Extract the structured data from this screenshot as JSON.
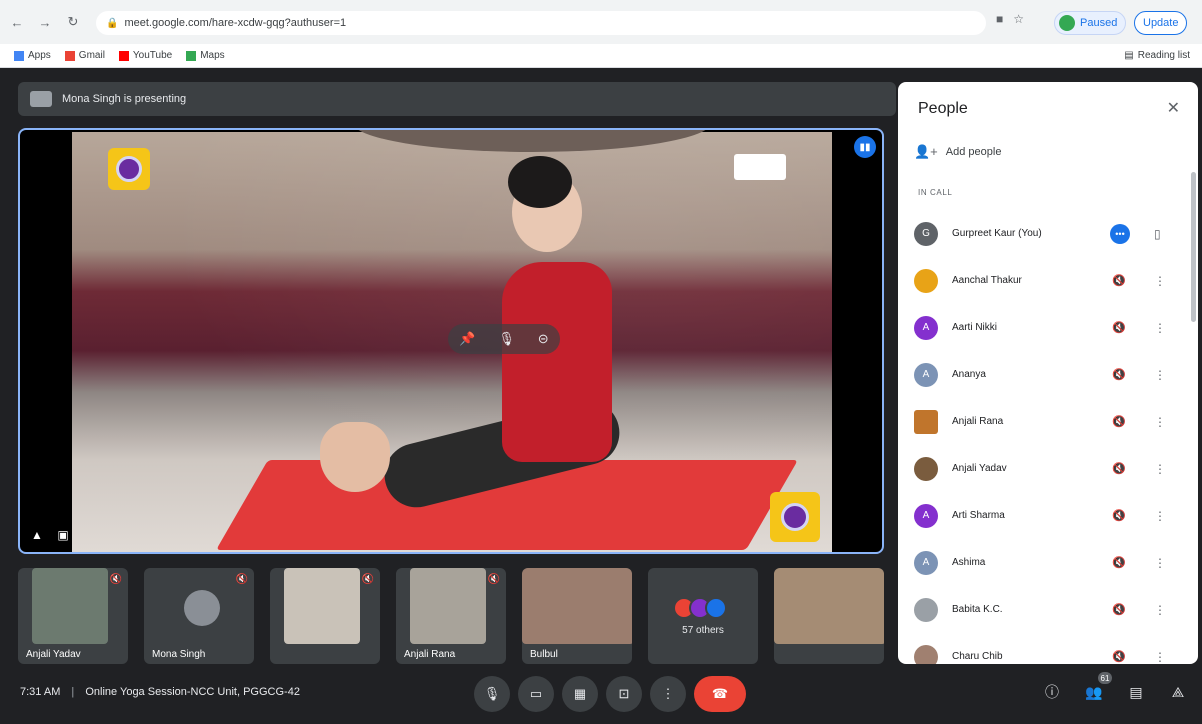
{
  "browser": {
    "url": "meet.google.com/hare-xcdw-gqg?authuser=1",
    "bookmarks": [
      {
        "label": "Apps",
        "color": "#4285f4"
      },
      {
        "label": "Gmail",
        "color": "#ea4335"
      },
      {
        "label": "YouTube",
        "color": "#ff0000"
      },
      {
        "label": "Maps",
        "color": "#34a853"
      }
    ],
    "paused_label": "Paused",
    "update_label": "Update",
    "reading_list_label": "Reading list"
  },
  "presentation": {
    "presenting_text": "Mona Singh is presenting"
  },
  "filmstrip": [
    {
      "name": "Anjali Yadav",
      "color": "#6c7a6f",
      "type": "video"
    },
    {
      "name": "Mona Singh",
      "color": "#3c4043",
      "type": "avatar"
    },
    {
      "name": "",
      "color": "#c9c2b8",
      "type": "video"
    },
    {
      "name": "Anjali Rana",
      "color": "#a8a39a",
      "type": "video"
    },
    {
      "name": "Bulbul",
      "color": "#9b7d6e",
      "type": "video"
    },
    {
      "name": "",
      "color": "#3c4043",
      "type": "others"
    },
    {
      "name": "",
      "color": "#a58c74",
      "type": "video"
    }
  ],
  "others": {
    "label": "57 others",
    "avatar_colors": [
      "#ea4335",
      "#8430ce",
      "#1a73e8"
    ]
  },
  "meeting": {
    "time": "7:31 AM",
    "separator": "|",
    "title": "Online Yoga Session-NCC Unit, PGGCG-42"
  },
  "controls": {
    "people_badge": "61"
  },
  "people_panel": {
    "title": "People",
    "add_people_label": "Add people",
    "section_label": "IN CALL",
    "participants": [
      {
        "name": "Gurpreet Kaur (You)",
        "avatar_color": "#5f6368",
        "initial": "G",
        "highlight": true
      },
      {
        "name": "Aanchal Thakur",
        "avatar_color": "#e8a317",
        "initial": "",
        "highlight": false
      },
      {
        "name": "Aarti Nikki",
        "avatar_color": "#8430ce",
        "initial": "A",
        "highlight": false
      },
      {
        "name": "Ananya",
        "avatar_color": "#7c93b5",
        "initial": "A",
        "highlight": false
      },
      {
        "name": "Anjali Rana",
        "avatar_color": "#c0752c",
        "initial": "",
        "highlight": false
      },
      {
        "name": "Anjali Yadav",
        "avatar_color": "#7a5c3e",
        "initial": "",
        "highlight": false
      },
      {
        "name": "Arti Sharma",
        "avatar_color": "#8430ce",
        "initial": "A",
        "highlight": false
      },
      {
        "name": "Ashima",
        "avatar_color": "#7c93b5",
        "initial": "A",
        "highlight": false
      },
      {
        "name": "Babita K.C.",
        "avatar_color": "#9aa0a6",
        "initial": "",
        "highlight": false
      },
      {
        "name": "Charu Chib",
        "avatar_color": "#a08070",
        "initial": "",
        "highlight": false
      }
    ]
  }
}
